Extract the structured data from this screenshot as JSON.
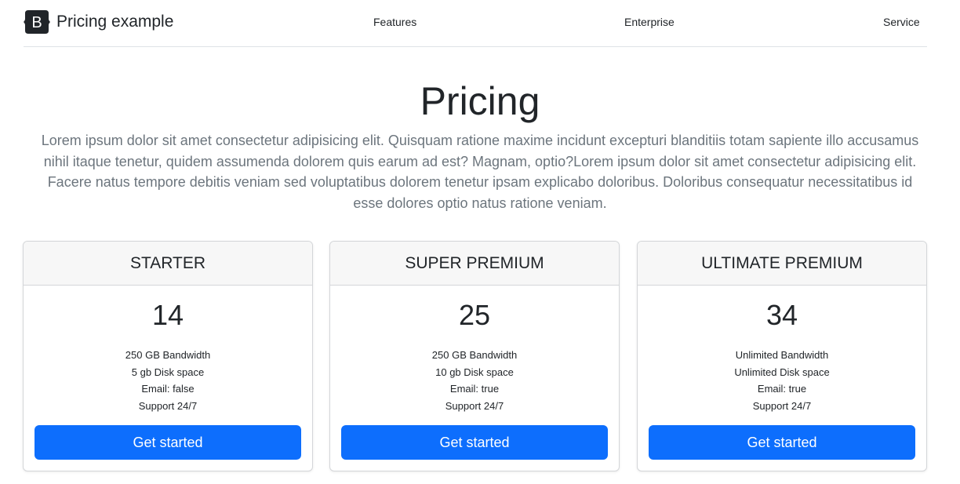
{
  "header": {
    "brand": "Pricing example",
    "brand_icon": "bootstrap-logo-icon",
    "brand_icon_letter": "B",
    "nav": [
      "Features",
      "Enterprise",
      "Service"
    ]
  },
  "hero": {
    "title": "Pricing",
    "lead": "Lorem ipsum dolor sit amet consectetur adipisicing elit. Quisquam ratione maxime incidunt excepturi blanditiis totam sapiente illo accusamus nihil itaque tenetur, quidem assumenda dolorem quis earum ad est? Magnam, optio?Lorem ipsum dolor sit amet consectetur adipisicing elit. Facere natus tempore debitis veniam sed voluptatibus dolorem tenetur ipsam explicabo doloribus. Doloribus consequatur necessitatibus id esse dolores optio natus ratione veniam."
  },
  "plans": [
    {
      "name": "STARTER",
      "price": "14",
      "features": [
        "250 GB Bandwidth",
        "5 gb Disk space",
        "Email: false",
        "Support 24/7"
      ],
      "button": "Get started"
    },
    {
      "name": "SUPER PREMIUM",
      "price": "25",
      "features": [
        "250 GB Bandwidth",
        "10 gb Disk space",
        "Email: true",
        "Support 24/7"
      ],
      "button": "Get started"
    },
    {
      "name": "ULTIMATE PREMIUM",
      "price": "34",
      "features": [
        "Unlimited Bandwidth",
        "Unlimited Disk space",
        "Email: true",
        "Support 24/7"
      ],
      "button": "Get started"
    }
  ],
  "colors": {
    "primary": "#0d6efd",
    "text": "#212529",
    "muted": "#6c757d",
    "card_header_bg": "#f7f7f7",
    "border": "#dee2e6"
  }
}
